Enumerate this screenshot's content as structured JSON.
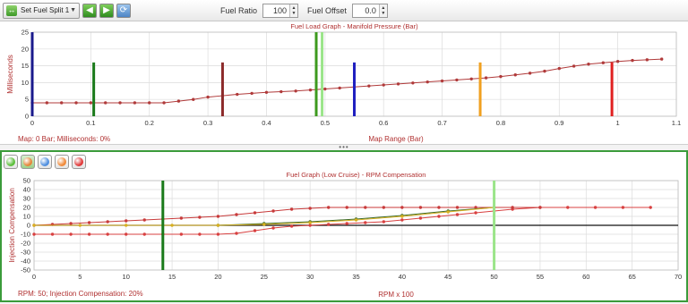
{
  "toolbar": {
    "split_label": "Set Fuel Split 1",
    "fuel_ratio_label": "Fuel Ratio",
    "fuel_ratio_value": "100",
    "fuel_offset_label": "Fuel Offset",
    "fuel_offset_value": "0.0",
    "icons": [
      "back-arrow-icon",
      "forward-arrow-icon",
      "refresh-icon"
    ]
  },
  "top_graph": {
    "status_text": "Map: 0 Bar; Milliseconds: 0%",
    "x_axis_title": "Map Range (Bar)"
  },
  "bottom_graph": {
    "status_text": "RPM: 50; Injection Compensation: 20%",
    "x_axis_title": "RPM x 100",
    "toolbar_buttons": [
      {
        "color": "#5cbf3c",
        "name": "green-series-button"
      },
      {
        "color": "#e5863a",
        "name": "orange-green-series-button"
      },
      {
        "color": "#4f8fdf",
        "name": "blue-series-button"
      },
      {
        "color": "#f08a3a",
        "name": "orange-series-button"
      },
      {
        "color": "#e03a3a",
        "name": "red-series-button"
      }
    ]
  },
  "chart_data": [
    {
      "type": "line",
      "title": "Fuel Load Graph - Manifold Pressure (Bar)",
      "xlabel": "Map Range (Bar)",
      "ylabel": "Milliseconds",
      "xlim": [
        0,
        1.1
      ],
      "ylim": [
        0,
        25
      ],
      "x_ticks": [
        0,
        0.1,
        0.2,
        0.3,
        0.4,
        0.5,
        0.6,
        0.7,
        0.8,
        0.9,
        1,
        1.1
      ],
      "y_ticks": [
        0,
        5,
        10,
        15,
        20,
        25
      ],
      "grid": true,
      "series": [
        {
          "color": "#b03a3a",
          "x": [
            0,
            0.025,
            0.05,
            0.075,
            0.1,
            0.125,
            0.15,
            0.175,
            0.2,
            0.225,
            0.25,
            0.275,
            0.3,
            0.325,
            0.35,
            0.375,
            0.4,
            0.425,
            0.45,
            0.475,
            0.5,
            0.525,
            0.55,
            0.575,
            0.6,
            0.625,
            0.65,
            0.675,
            0.7,
            0.725,
            0.75,
            0.775,
            0.8,
            0.825,
            0.85,
            0.875,
            0.9,
            0.925,
            0.95,
            0.975,
            1.0,
            1.025,
            1.05,
            1.075
          ],
          "y": [
            4,
            4,
            4,
            4,
            4,
            4,
            4,
            4,
            4,
            4,
            4.5,
            5,
            5.7,
            6.1,
            6.5,
            6.8,
            7.1,
            7.3,
            7.5,
            7.8,
            8.1,
            8.4,
            8.7,
            9.0,
            9.3,
            9.6,
            9.9,
            10.2,
            10.5,
            10.8,
            11.1,
            11.4,
            11.8,
            12.3,
            12.8,
            13.4,
            14.2,
            14.9,
            15.5,
            15.9,
            16.3,
            16.6,
            16.8,
            17
          ]
        }
      ],
      "markers": [
        {
          "x": 0.0,
          "top": 25,
          "color": "#1a1a8c"
        },
        {
          "x": 0.105,
          "top": 16,
          "color": "#1a7a1a"
        },
        {
          "x": 0.325,
          "top": 16,
          "color": "#8c2a2a"
        },
        {
          "x": 0.485,
          "top": 25,
          "color": "#3d9a1e"
        },
        {
          "x": 0.495,
          "top": 25,
          "color": "#9be58a"
        },
        {
          "x": 0.55,
          "top": 16,
          "color": "#2020c0"
        },
        {
          "x": 0.765,
          "top": 16,
          "color": "#f0a020"
        },
        {
          "x": 0.99,
          "top": 16,
          "color": "#e02020"
        }
      ]
    },
    {
      "type": "line",
      "title": "Fuel Graph (Low Cruise) - RPM Compensation",
      "xlabel": "RPM x 100",
      "ylabel": "Injection Compensation",
      "xlim": [
        0,
        70
      ],
      "ylim": [
        -50,
        50
      ],
      "x_ticks": [
        0,
        5,
        10,
        15,
        20,
        25,
        30,
        35,
        40,
        45,
        50,
        55,
        60,
        65,
        70
      ],
      "y_ticks": [
        50,
        40,
        30,
        20,
        10,
        0,
        -10,
        -20,
        -30,
        -40,
        -50
      ],
      "grid": true,
      "zero_line": true,
      "series": [
        {
          "color": "#d84040",
          "x": [
            0,
            2,
            4,
            6,
            8,
            10,
            12,
            14,
            16,
            18,
            20,
            22,
            24,
            26,
            28,
            30,
            32,
            34,
            36,
            38,
            40,
            42,
            44,
            46,
            48,
            50,
            52,
            55,
            58,
            61,
            64,
            67
          ],
          "y": [
            -10,
            -10,
            -10,
            -10,
            -10,
            -10,
            -10,
            -10,
            -10,
            -10,
            -10,
            -9,
            -6,
            -3,
            -1,
            0,
            1,
            2,
            3,
            4,
            6,
            8,
            10,
            12,
            14,
            16,
            18,
            20,
            20,
            20,
            20,
            20
          ]
        },
        {
          "color": "#c83a3a",
          "x": [
            0,
            2,
            4,
            6,
            8,
            10,
            12,
            14,
            16,
            18,
            20,
            22,
            24,
            26,
            28,
            30,
            32,
            34,
            36,
            38,
            40,
            42,
            44,
            46,
            48,
            50,
            52,
            55
          ],
          "y": [
            0,
            1,
            2,
            3,
            4,
            5,
            6,
            7,
            8,
            9,
            10,
            12,
            14,
            16,
            18,
            19,
            20,
            20,
            20,
            20,
            20,
            20,
            20,
            20,
            20,
            20,
            20,
            20
          ]
        },
        {
          "color": "#3a6a2a",
          "x": [
            20,
            25,
            30,
            35,
            40,
            45,
            50
          ],
          "y": [
            0,
            2,
            4,
            7,
            11,
            16,
            20
          ]
        },
        {
          "color": "#d8b020",
          "x": [
            0,
            5,
            10,
            15,
            20,
            25,
            30,
            35,
            40,
            45,
            50
          ],
          "y": [
            0,
            0,
            0,
            0,
            0,
            1,
            3,
            6,
            10,
            15,
            20
          ]
        }
      ],
      "markers": [
        {
          "x": 14,
          "bottom": -50,
          "top": 50,
          "color": "#1a7a1a"
        },
        {
          "x": 50,
          "bottom": -50,
          "top": 50,
          "color": "#9be58a"
        }
      ]
    }
  ]
}
